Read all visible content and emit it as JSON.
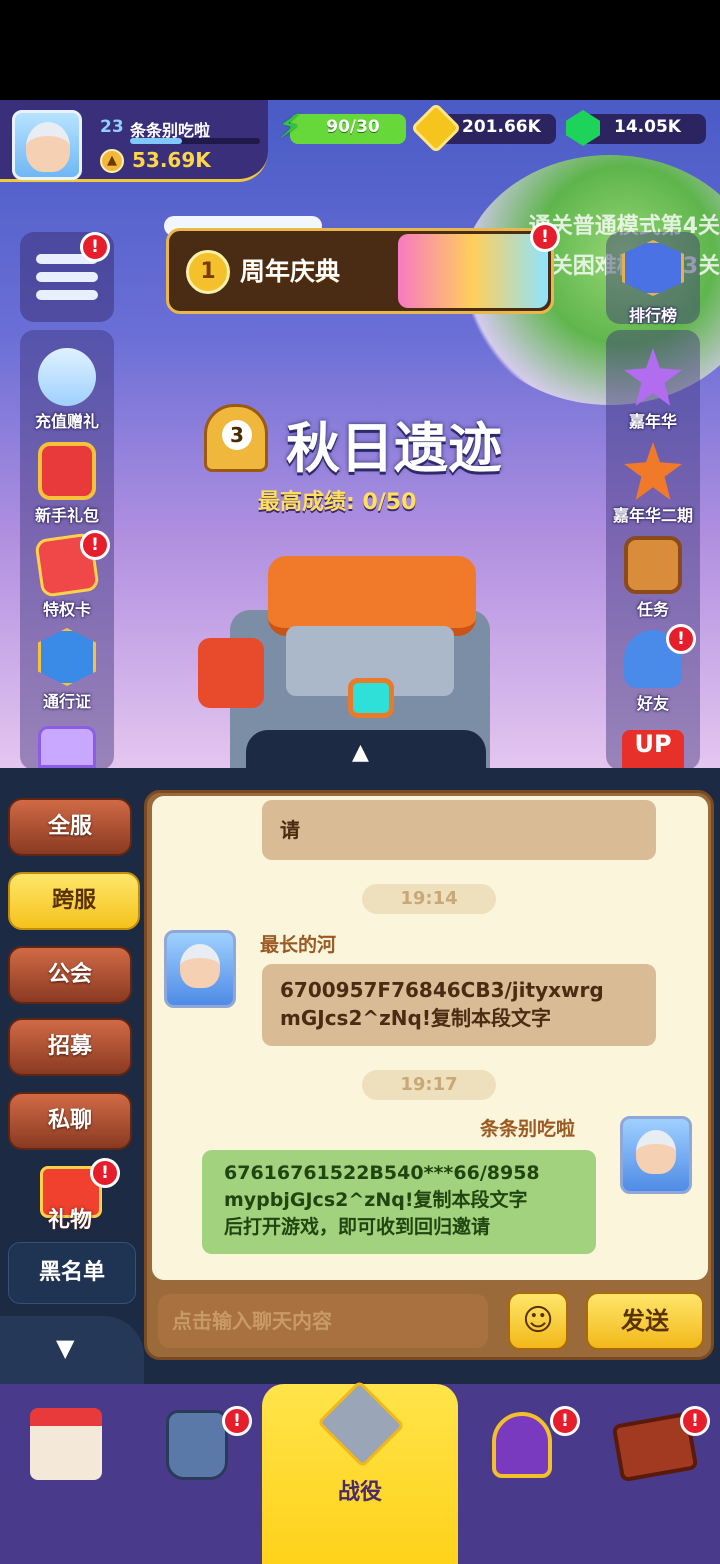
{
  "player": {
    "level": "23",
    "name": "条条别吃啦",
    "power": "53.69K"
  },
  "resources": {
    "energy": "90/30",
    "gold": "201.66K",
    "gems": "14.05K"
  },
  "scene": {
    "mode_text_1": "通关普通模式第4关",
    "mode_text_2": "关困难模式第3关",
    "anniversary_title": "周年庆典",
    "anniversary_medal": "1",
    "stage_number": "3",
    "stage_name": "秋日遗迹",
    "best_score": "最高成绩: 0/50"
  },
  "left_menu": [
    {
      "label": "充值赠礼",
      "badge": ""
    },
    {
      "label": "新手礼包",
      "badge": ""
    },
    {
      "label": "特权卡",
      "badge": "!"
    },
    {
      "label": "通行证",
      "badge": ""
    }
  ],
  "right_menu": [
    {
      "label": "排行榜",
      "badge": ""
    },
    {
      "label": "嘉年华",
      "badge": ""
    },
    {
      "label": "嘉年华二期",
      "badge": ""
    },
    {
      "label": "任务",
      "badge": ""
    },
    {
      "label": "好友",
      "badge": "!"
    }
  ],
  "badges": {
    "menu": "!",
    "anniversary": "!"
  },
  "chat": {
    "tabs": [
      "全服",
      "跨服",
      "公会",
      "招募",
      "私聊",
      "礼物"
    ],
    "active_tab": "跨服",
    "gift_badge": "!",
    "blacklist": "黑名单",
    "messages": [
      {
        "type": "other_partial",
        "text": "请"
      },
      {
        "type": "time",
        "text": "19:14"
      },
      {
        "type": "other",
        "sender": "最长的河",
        "text_line1": "6700957F76846CB3/jityxwrg",
        "text_line2": "mGJcs2^zNq!复制本段文字"
      },
      {
        "type": "time",
        "text": "19:17"
      },
      {
        "type": "self",
        "sender": "条条别吃啦",
        "text_line1": "67616761522B540***66/8958",
        "text_line2": "mypbjGJcs2^zNq!复制本段文字",
        "text_line3": "后打开游戏，即可收到回归邀请"
      }
    ],
    "input_placeholder": "点击输入聊天内容",
    "send": "发送"
  },
  "bottom_nav": {
    "battle_label": "战役",
    "badge": "!"
  }
}
